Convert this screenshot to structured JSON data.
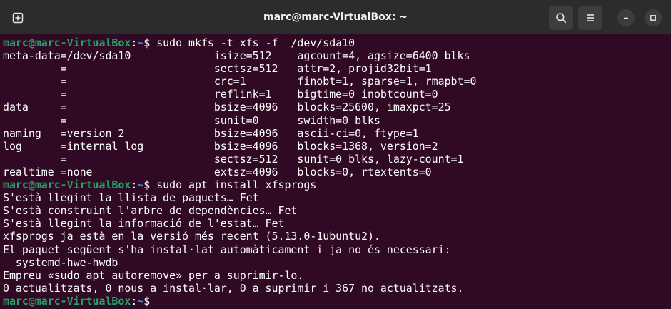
{
  "window": {
    "title": "marc@marc-VirtualBox: ~"
  },
  "icons": {
    "new_tab": "new-tab-icon",
    "search": "search-icon",
    "menu": "hamburger-menu-icon",
    "minimize": "minimize-icon",
    "maximize": "maximize-icon"
  },
  "colors": {
    "background": "#300a24",
    "titlebar": "#2c2c2c",
    "prompt_user": "#26a269",
    "prompt_path": "#4a8fd8",
    "text": "#ffffff"
  },
  "prompt": {
    "user_host": "marc@marc-VirtualBox",
    "colon": ":",
    "path": "~",
    "dollar": "$ "
  },
  "terminal": {
    "lines": [
      {
        "type": "prompt",
        "command": "sudo mkfs -t xfs -f  /dev/sda10"
      },
      {
        "type": "output",
        "text": "meta-data=/dev/sda10             isize=512    agcount=4, agsize=6400 blks"
      },
      {
        "type": "output",
        "text": "         =                       sectsz=512   attr=2, projid32bit=1"
      },
      {
        "type": "output",
        "text": "         =                       crc=1        finobt=1, sparse=1, rmapbt=0"
      },
      {
        "type": "output",
        "text": "         =                       reflink=1    bigtime=0 inobtcount=0"
      },
      {
        "type": "output",
        "text": "data     =                       bsize=4096   blocks=25600, imaxpct=25"
      },
      {
        "type": "output",
        "text": "         =                       sunit=0      swidth=0 blks"
      },
      {
        "type": "output",
        "text": "naming   =version 2              bsize=4096   ascii-ci=0, ftype=1"
      },
      {
        "type": "output",
        "text": "log      =internal log           bsize=4096   blocks=1368, version=2"
      },
      {
        "type": "output",
        "text": "         =                       sectsz=512   sunit=0 blks, lazy-count=1"
      },
      {
        "type": "output",
        "text": "realtime =none                   extsz=4096   blocks=0, rtextents=0"
      },
      {
        "type": "prompt",
        "command": "sudo apt install xfsprogs"
      },
      {
        "type": "output",
        "text": "S'està llegint la llista de paquets… Fet"
      },
      {
        "type": "output",
        "text": "S'està construint l'arbre de dependències… Fet"
      },
      {
        "type": "output",
        "text": "S'està llegint la informació de l'estat… Fet"
      },
      {
        "type": "output",
        "text": "xfsprogs ja està en la versió més recent (5.13.0-1ubuntu2)."
      },
      {
        "type": "output",
        "text": "El paquet següent s'ha instal·lat automàticament i ja no és necessari:"
      },
      {
        "type": "output",
        "text": "  systemd-hwe-hwdb"
      },
      {
        "type": "output",
        "text": "Empreu «sudo apt autoremove» per a suprimir-lo."
      },
      {
        "type": "output",
        "text": "0 actualitzats, 0 nous a instal·lar, 0 a suprimir i 367 no actualitzats."
      },
      {
        "type": "prompt",
        "command": ""
      }
    ]
  }
}
